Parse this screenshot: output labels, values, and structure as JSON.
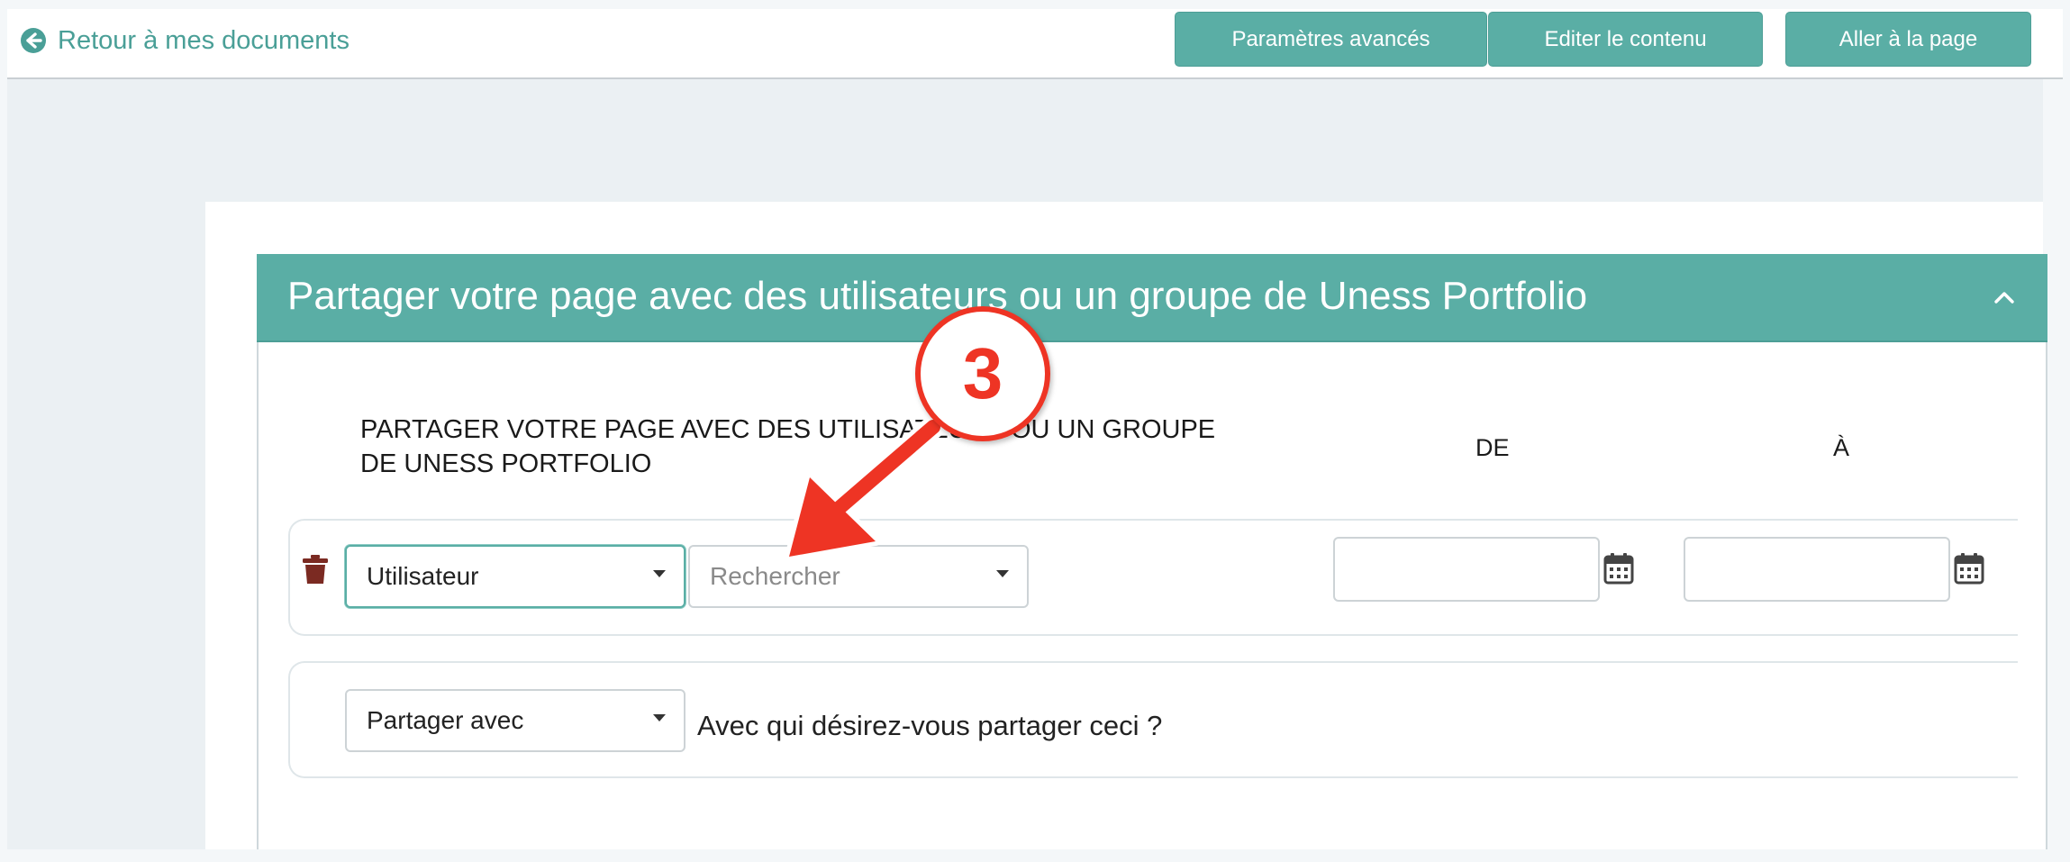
{
  "topbar": {
    "back_label": "Retour à mes documents",
    "buttons": {
      "advanced": "Paramètres avancés",
      "edit": "Editer le contenu",
      "goto": "Aller à la page"
    }
  },
  "panel": {
    "title": "Partager votre page avec des utilisateurs ou un groupe de Uness Portfolio",
    "columns": {
      "share_heading_line1": "PARTAGER VOTRE PAGE AVEC DES UTILISATEURS OU UN GROUPE",
      "share_heading_line2": "DE UNESS PORTFOLIO",
      "from": "DE",
      "to": "À"
    },
    "share_row": {
      "type_value": "Utilisateur",
      "search_placeholder": "Rechercher",
      "from_value": "",
      "to_value": ""
    },
    "share_with": {
      "value": "Partager avec",
      "hint": "Avec qui désirez-vous partager ceci ?"
    }
  },
  "annotation": {
    "step_number": "3"
  },
  "colors": {
    "accent": "#5aaea5",
    "annotation_red": "#ee3424",
    "trash": "#7b2a22"
  },
  "icons": [
    "arrow-left-circle-icon",
    "chevron-up-icon",
    "trash-icon",
    "calendar-icon",
    "caret-down-icon"
  ]
}
